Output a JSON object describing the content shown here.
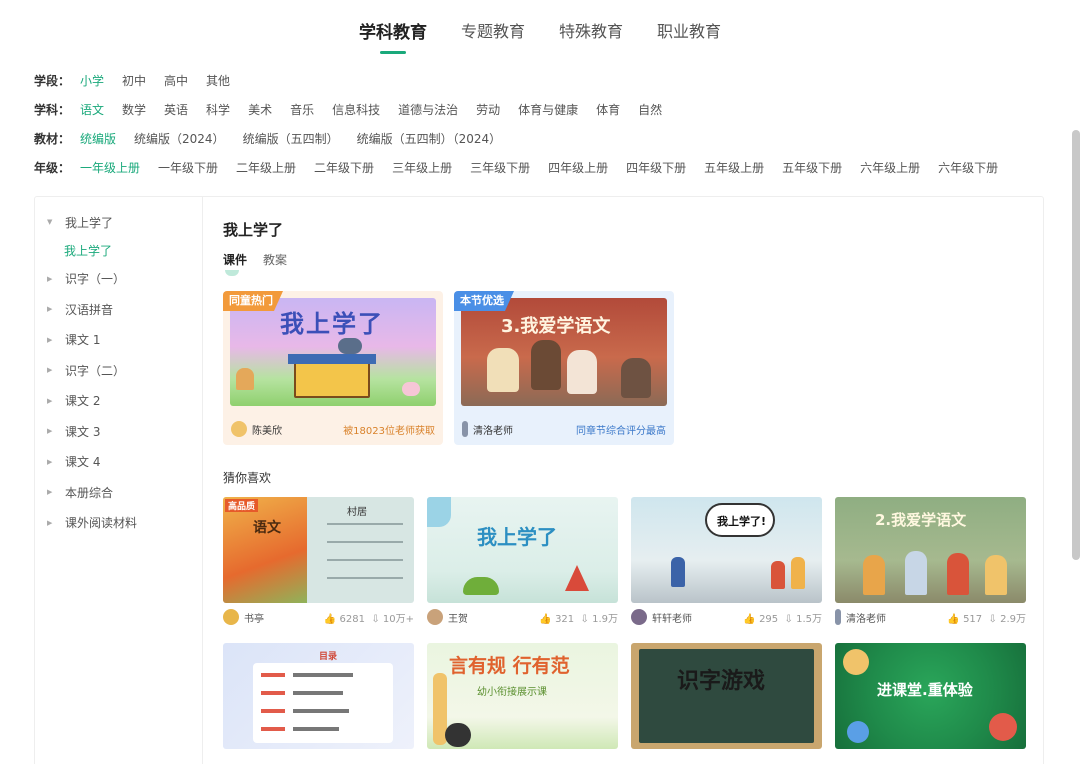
{
  "top_tabs": [
    "学科教育",
    "专题教育",
    "特殊教育",
    "职业教育"
  ],
  "filters": {
    "stage": {
      "label": "学段：",
      "options": [
        "小学",
        "初中",
        "高中",
        "其他"
      ]
    },
    "subject": {
      "label": "学科：",
      "options": [
        "语文",
        "数学",
        "英语",
        "科学",
        "美术",
        "音乐",
        "信息科技",
        "道德与法治",
        "劳动",
        "体育与健康",
        "体育",
        "自然"
      ]
    },
    "textbook": {
      "label": "教材：",
      "options": [
        "统编版",
        "统编版（2024）",
        "统编版（五四制）",
        "统编版（五四制）（2024）"
      ]
    },
    "grade": {
      "label": "年级：",
      "options": [
        "一年级上册",
        "一年级下册",
        "二年级上册",
        "二年级下册",
        "三年级上册",
        "三年级下册",
        "四年级上册",
        "四年级下册",
        "五年级上册",
        "五年级下册",
        "六年级上册",
        "六年级下册"
      ]
    }
  },
  "sidebar": {
    "items": [
      "我上学了",
      "识字（一）",
      "汉语拼音",
      "课文 1",
      "识字（二）",
      "课文 2",
      "课文 3",
      "课文 4",
      "本册综合",
      "课外阅读材料"
    ],
    "sub_item": "我上学了"
  },
  "content": {
    "title": "我上学了",
    "tabs": [
      "课件",
      "教案"
    ],
    "featured": [
      {
        "badge": "同童热门",
        "thumb_title": "我上学了",
        "author": "陈美欣",
        "note": "被18023位老师获取"
      },
      {
        "badge": "本节优选",
        "thumb_title": "3.我爱学语文",
        "author": "清洛老师",
        "note": "同章节综合评分最高"
      }
    ],
    "guess_title": "猜你喜欢",
    "cards": [
      {
        "author": "书亭",
        "likes": "6281",
        "downloads": "10万+",
        "thumb_text": "村居",
        "thumb_label": "语文",
        "thumb_badge": "高品质"
      },
      {
        "author": "王贺",
        "likes": "321",
        "downloads": "1.9万",
        "thumb_text": "我上学了"
      },
      {
        "author": "轩轩老师",
        "likes": "295",
        "downloads": "1.5万",
        "thumb_text": "我上学了!"
      },
      {
        "author": "清洛老师",
        "likes": "517",
        "downloads": "2.9万",
        "thumb_text": "2.我爱学语文"
      },
      {
        "author": "",
        "likes": "",
        "downloads": "",
        "thumb_text": "目录"
      },
      {
        "author": "",
        "likes": "",
        "downloads": "",
        "thumb_text": "言有规 行有范",
        "thumb_sub": "幼小衔接展示课"
      },
      {
        "author": "",
        "likes": "",
        "downloads": "",
        "thumb_text": "识字游戏"
      },
      {
        "author": "",
        "likes": "",
        "downloads": "",
        "thumb_text": "进课堂.重体验"
      }
    ]
  },
  "colors": {
    "accent": "#1aa97b",
    "badge_orange": "#f29a3b",
    "badge_blue": "#4a8fe6"
  }
}
